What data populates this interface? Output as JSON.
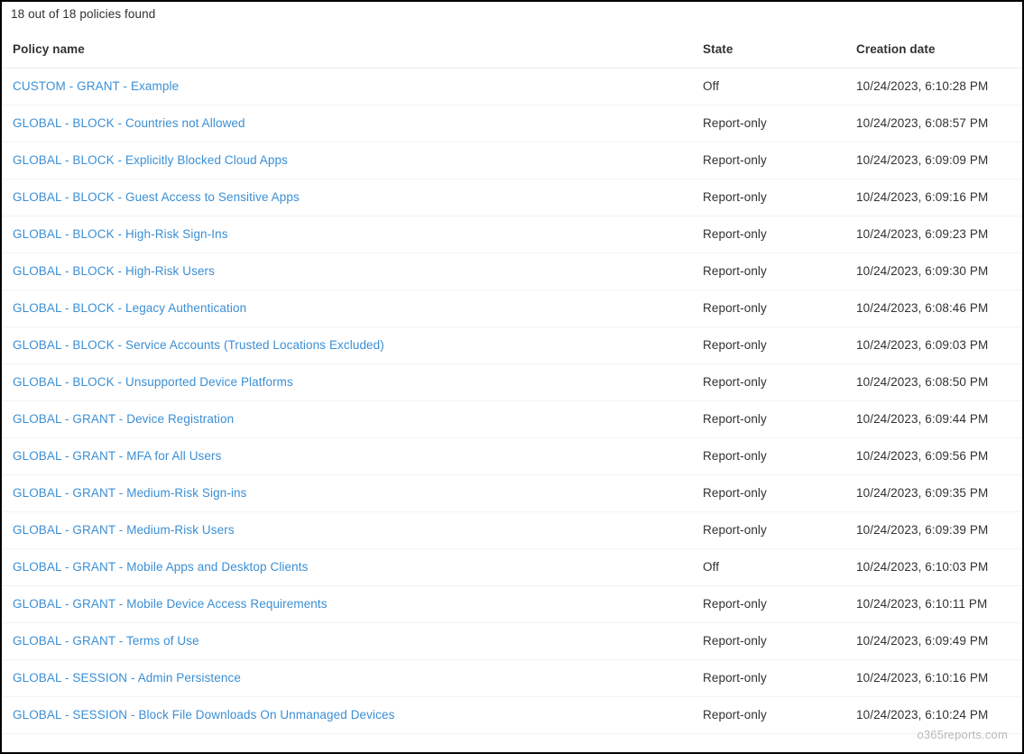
{
  "header": {
    "result_count": "18 out of 18 policies found"
  },
  "table": {
    "columns": [
      {
        "key": "name",
        "label": "Policy name"
      },
      {
        "key": "state",
        "label": "State"
      },
      {
        "key": "date",
        "label": "Creation date"
      }
    ],
    "rows": [
      {
        "name": "CUSTOM - GRANT - Example",
        "state": "Off",
        "date": "10/24/2023, 6:10:28 PM"
      },
      {
        "name": "GLOBAL - BLOCK - Countries not Allowed",
        "state": "Report-only",
        "date": "10/24/2023, 6:08:57 PM"
      },
      {
        "name": "GLOBAL - BLOCK - Explicitly Blocked Cloud Apps",
        "state": "Report-only",
        "date": "10/24/2023, 6:09:09 PM"
      },
      {
        "name": "GLOBAL - BLOCK - Guest Access to Sensitive Apps",
        "state": "Report-only",
        "date": "10/24/2023, 6:09:16 PM"
      },
      {
        "name": "GLOBAL - BLOCK - High-Risk Sign-Ins",
        "state": "Report-only",
        "date": "10/24/2023, 6:09:23 PM"
      },
      {
        "name": "GLOBAL - BLOCK - High-Risk Users",
        "state": "Report-only",
        "date": "10/24/2023, 6:09:30 PM"
      },
      {
        "name": "GLOBAL - BLOCK - Legacy Authentication",
        "state": "Report-only",
        "date": "10/24/2023, 6:08:46 PM"
      },
      {
        "name": "GLOBAL - BLOCK - Service Accounts (Trusted Locations Excluded)",
        "state": "Report-only",
        "date": "10/24/2023, 6:09:03 PM"
      },
      {
        "name": "GLOBAL - BLOCK - Unsupported Device Platforms",
        "state": "Report-only",
        "date": "10/24/2023, 6:08:50 PM"
      },
      {
        "name": "GLOBAL - GRANT - Device Registration",
        "state": "Report-only",
        "date": "10/24/2023, 6:09:44 PM"
      },
      {
        "name": "GLOBAL - GRANT - MFA for All Users",
        "state": "Report-only",
        "date": "10/24/2023, 6:09:56 PM"
      },
      {
        "name": "GLOBAL - GRANT - Medium-Risk Sign-ins",
        "state": "Report-only",
        "date": "10/24/2023, 6:09:35 PM"
      },
      {
        "name": "GLOBAL - GRANT - Medium-Risk Users",
        "state": "Report-only",
        "date": "10/24/2023, 6:09:39 PM"
      },
      {
        "name": "GLOBAL - GRANT - Mobile Apps and Desktop Clients",
        "state": "Off",
        "date": "10/24/2023, 6:10:03 PM"
      },
      {
        "name": "GLOBAL - GRANT - Mobile Device Access Requirements",
        "state": "Report-only",
        "date": "10/24/2023, 6:10:11 PM"
      },
      {
        "name": "GLOBAL - GRANT - Terms of Use",
        "state": "Report-only",
        "date": "10/24/2023, 6:09:49 PM"
      },
      {
        "name": "GLOBAL - SESSION - Admin Persistence",
        "state": "Report-only",
        "date": "10/24/2023, 6:10:16 PM"
      },
      {
        "name": "GLOBAL - SESSION - Block File Downloads On Unmanaged Devices",
        "state": "Report-only",
        "date": "10/24/2023, 6:10:24 PM"
      }
    ]
  },
  "watermark": {
    "text": "o365reports.com"
  },
  "colors": {
    "link": "#3b8fd4",
    "text": "#323130",
    "row_divider": "#f3f2f1",
    "header_divider": "#edebe9",
    "background": "#ffffff",
    "watermark": "#b8b8b8"
  }
}
